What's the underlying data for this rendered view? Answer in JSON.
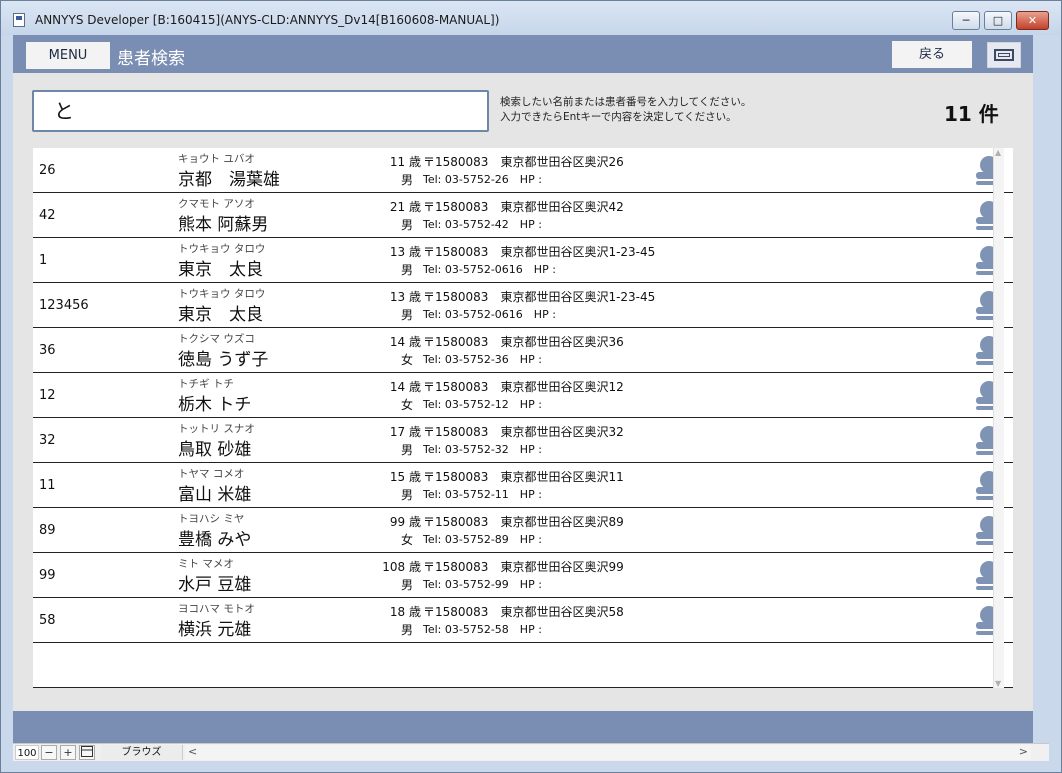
{
  "window": {
    "title": "ANNYYS Developer [B:160415](ANYS-CLD:ANNYYS_Dv14[B160608-MANUAL])",
    "min_glyph": "─",
    "max_glyph": "□",
    "close_glyph": "✕"
  },
  "header": {
    "menu_label": "MENU",
    "page_title": "患者検索",
    "back_label": "戻る"
  },
  "search": {
    "value": "と",
    "hint_line1": "検索したい名前または患者番号を入力してください。",
    "hint_line2": "入力できたらEntキーで内容を決定してください。",
    "count": "11 件"
  },
  "patients": [
    {
      "id": "26",
      "kana": "キョウト ユバオ",
      "name": "京都　湯葉雄",
      "age": "11 歳",
      "gender": "男",
      "address": "〒1580083　東京都世田谷区奥沢26",
      "contact": "Tel: 03-5752-26　HP :"
    },
    {
      "id": "42",
      "kana": "クマモト アソオ",
      "name": "熊本 阿蘇男",
      "age": "21 歳",
      "gender": "男",
      "address": "〒1580083　東京都世田谷区奥沢42",
      "contact": "Tel: 03-5752-42　HP :"
    },
    {
      "id": "1",
      "kana": "トウキョウ タロウ",
      "name": "東京　太良",
      "age": "13 歳",
      "gender": "男",
      "address": "〒1580083　東京都世田谷区奥沢1-23-45",
      "contact": "Tel: 03-5752-0616　HP :"
    },
    {
      "id": "123456",
      "kana": "トウキョウ タロウ",
      "name": "東京　太良",
      "age": "13 歳",
      "gender": "男",
      "address": "〒1580083　東京都世田谷区奥沢1-23-45",
      "contact": "Tel: 03-5752-0616　HP :"
    },
    {
      "id": "36",
      "kana": "トクシマ ウズコ",
      "name": "徳島 うず子",
      "age": "14 歳",
      "gender": "女",
      "address": "〒1580083　東京都世田谷区奥沢36",
      "contact": "Tel: 03-5752-36　HP :"
    },
    {
      "id": "12",
      "kana": "トチギ トチ",
      "name": "栃木 トチ",
      "age": "14 歳",
      "gender": "女",
      "address": "〒1580083　東京都世田谷区奥沢12",
      "contact": "Tel: 03-5752-12　HP :"
    },
    {
      "id": "32",
      "kana": "トットリ スナオ",
      "name": "鳥取 砂雄",
      "age": "17 歳",
      "gender": "男",
      "address": "〒1580083　東京都世田谷区奥沢32",
      "contact": "Tel: 03-5752-32　HP :"
    },
    {
      "id": "11",
      "kana": "トヤマ コメオ",
      "name": "富山 米雄",
      "age": "15 歳",
      "gender": "男",
      "address": "〒1580083　東京都世田谷区奥沢11",
      "contact": "Tel: 03-5752-11　HP :"
    },
    {
      "id": "89",
      "kana": "トヨハシ ミヤ",
      "name": "豊橋 みや",
      "age": "99 歳",
      "gender": "女",
      "address": "〒1580083　東京都世田谷区奥沢89",
      "contact": "Tel: 03-5752-89　HP :"
    },
    {
      "id": "99",
      "kana": "ミト マメオ",
      "name": "水戸 豆雄",
      "age": "108 歳",
      "gender": "男",
      "address": "〒1580083　東京都世田谷区奥沢99",
      "contact": "Tel: 03-5752-99　HP :"
    },
    {
      "id": "58",
      "kana": "ヨコハマ モトオ",
      "name": "横浜 元雄",
      "age": "18 歳",
      "gender": "男",
      "address": "〒1580083　東京都世田谷区奥沢58",
      "contact": "Tel: 03-5752-58　HP :"
    }
  ],
  "icons": {
    "avatar": "person-icon",
    "screen": "fullscreen-icon"
  },
  "colors": {
    "header_bar": "#7a8db3",
    "search_border": "#6d87a9",
    "avatar": "#7f93b5"
  },
  "statusbar": {
    "zoom": "100",
    "minus_glyph": "−",
    "plus_glyph": "+",
    "mode": "ブラウズ",
    "left_arrow": "<",
    "right_arrow": ">"
  }
}
